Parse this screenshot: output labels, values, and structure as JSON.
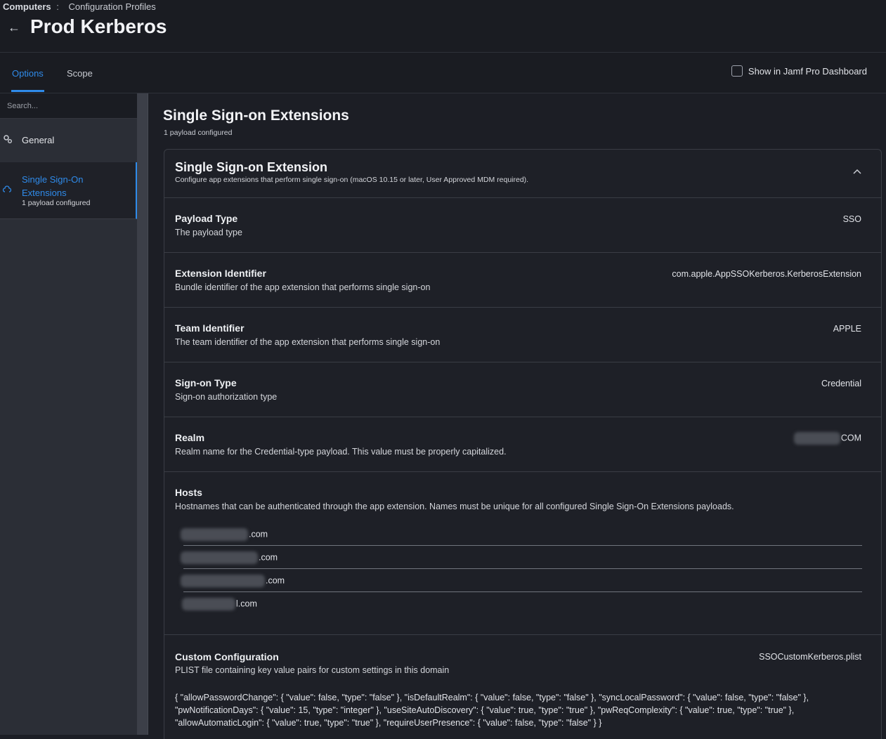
{
  "breadcrumb": {
    "parent": "Computers",
    "separator": ":",
    "current": "Configuration Profiles"
  },
  "page_title": "Prod Kerberos",
  "tabs": [
    {
      "label": "Options"
    },
    {
      "label": "Scope"
    }
  ],
  "dashboard_checkbox": {
    "label": "Show in Jamf Pro Dashboard",
    "checked": false
  },
  "sidebar": {
    "search_placeholder": "Search...",
    "items": [
      {
        "label": "General",
        "icon": "gear-icon"
      },
      {
        "label": "Single Sign-On Extensions",
        "sub": "1 payload configured",
        "icon": "cloud-icon"
      }
    ]
  },
  "section": {
    "title": "Single Sign-on Extensions",
    "subtitle": "1 payload configured"
  },
  "card": {
    "title": "Single Sign-on Extension",
    "description": "Configure app extensions that perform single sign-on (macOS 10.15 or later, User Approved MDM required).",
    "fields": [
      {
        "label": "Payload Type",
        "description": "The payload type",
        "value": "SSO"
      },
      {
        "label": "Extension Identifier",
        "description": "Bundle identifier of the app extension that performs single sign-on",
        "value": "com.apple.AppSSOKerberos.KerberosExtension"
      },
      {
        "label": "Team Identifier",
        "description": "The team identifier of the app extension that performs single sign-on",
        "value": "APPLE"
      },
      {
        "label": "Sign-on Type",
        "description": "Sign-on authorization type",
        "value": "Credential"
      },
      {
        "label": "Realm",
        "description": "Realm name for the Credential-type payload. This value must be properly capitalized.",
        "value": "COM"
      }
    ],
    "hosts": {
      "label": "Hosts",
      "description": "Hostnames that can be authenticated through the app extension. Names must be unique for all configured Single Sign-On Extensions payloads.",
      "items": [
        ".com",
        ".com",
        ".com",
        "l.com"
      ]
    },
    "custom": {
      "label": "Custom Configuration",
      "description": "PLIST file containing key value pairs for custom settings in this domain",
      "value": "SSOCustomKerberos.plist",
      "content": "{ \"allowPasswordChange\": { \"value\": false, \"type\": \"false\" }, \"isDefaultRealm\": { \"value\": false, \"type\": \"false\" }, \"syncLocalPassword\": { \"value\": false, \"type\": \"false\" }, \"pwNotificationDays\": { \"value\": 15, \"type\": \"integer\" }, \"useSiteAutoDiscovery\": { \"value\": true, \"type\": \"true\" }, \"pwReqComplexity\": { \"value\": true, \"type\": \"true\" }, \"allowAutomaticLogin\": { \"value\": true, \"type\": \"true\" }, \"requireUserPresence\": { \"value\": false, \"type\": \"false\" } }"
    }
  },
  "colors": {
    "accent": "#2f8bea",
    "background": "#1c1e25",
    "sidebar": "#2b2e36"
  }
}
